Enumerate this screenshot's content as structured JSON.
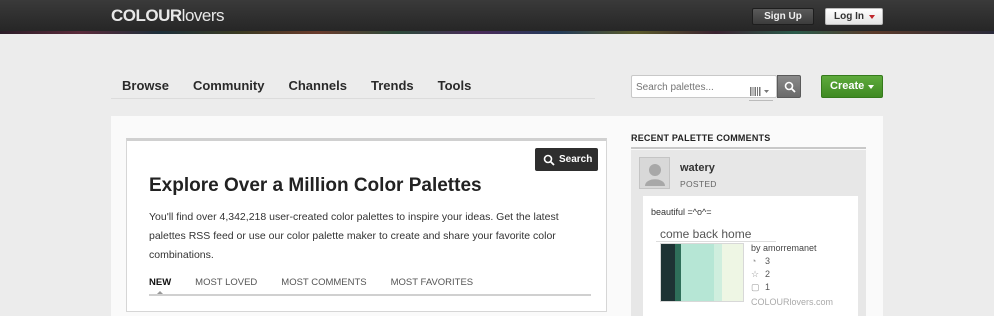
{
  "header": {
    "logo_bold": "COLOUR",
    "logo_light": "lovers",
    "signup_label": "Sign Up",
    "login_label": "Log In"
  },
  "nav": {
    "items": [
      {
        "label": "Browse"
      },
      {
        "label": "Community"
      },
      {
        "label": "Channels"
      },
      {
        "label": "Trends"
      },
      {
        "label": "Tools"
      }
    ]
  },
  "search": {
    "placeholder": "Search palettes..."
  },
  "create": {
    "label": "Create"
  },
  "hero": {
    "search_label": "Search",
    "title": "Explore Over a Million Color Palettes",
    "description": "You'll find over 4,342,218 user-created color palettes to inspire your ideas. Get the latest palettes RSS feed or use our color palette maker to create and share your favorite color combinations.",
    "tabs": [
      {
        "label": "NEW"
      },
      {
        "label": "MOST LOVED"
      },
      {
        "label": "MOST COMMENTS"
      },
      {
        "label": "MOST FAVORITES"
      }
    ]
  },
  "sidebar": {
    "title": "RECENT PALETTE COMMENTS",
    "comment": {
      "user": "watery",
      "status": "POSTED",
      "text": "beautiful =^o^=",
      "palette_title": "come back home",
      "palette_by": "by amorremanet",
      "views": "3",
      "loves": "2",
      "comments": "1",
      "footer": "COLOURlovers.com",
      "swatch_colors": [
        "#1e3334",
        "#2f6f5a",
        "#b6e6d5",
        "#cfeede",
        "#eef6e4"
      ]
    }
  },
  "colors": {
    "accent_green": "#4a9b2d",
    "topbar": "#2e2e2e",
    "login_caret": "#c0262c"
  }
}
